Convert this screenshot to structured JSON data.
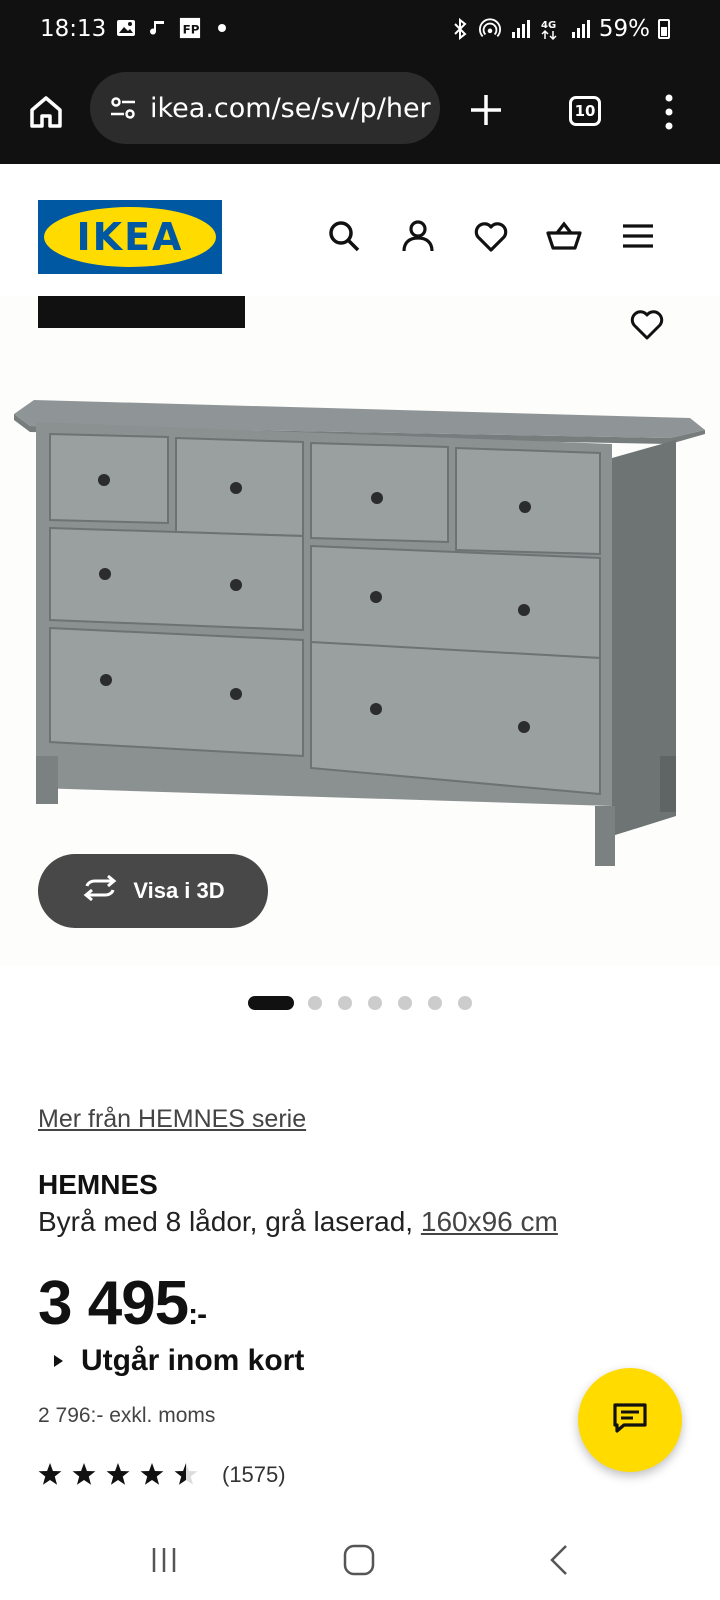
{
  "status_bar": {
    "time": "18:13",
    "battery": "59%"
  },
  "browser": {
    "url": "ikea.com/se/sv/p/her",
    "tab_count": "10"
  },
  "header": {
    "logo_text": "IKEA",
    "icons": [
      "search-icon",
      "account-icon",
      "wishlist-heart-icon",
      "basket-icon",
      "menu-icon"
    ]
  },
  "gallery": {
    "view_3d_label": "Visa i 3D",
    "image_count": 7,
    "active_index": 0
  },
  "product": {
    "series_link": "Mer från HEMNES serie",
    "name": "HEMNES",
    "description": "Byrå med 8 lådor, grå laserad,",
    "size_link": "160x96 cm",
    "price": "3 495",
    "price_suffix": ":-",
    "availability": "Utgår inom kort",
    "price_ex_vat": "2 796:- exkl. moms",
    "rating_value": 4.5,
    "rating_count": "(1575)"
  },
  "colors": {
    "ikea_blue": "#0058a3",
    "ikea_yellow": "#ffdb00",
    "button_dark": "#484848"
  }
}
